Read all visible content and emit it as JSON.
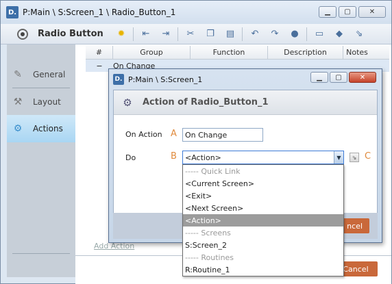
{
  "app": {
    "logo": "D.",
    "title": "P:Main \\ S:Screen_1 \\ Radio_Button_1",
    "window_buttons": [
      "minimize",
      "maximize",
      "close"
    ]
  },
  "toolbar": {
    "title": "Radio Button",
    "icons": [
      "lightbulb-icon",
      "outdent-icon",
      "indent-icon",
      "cut-icon",
      "copy-icon",
      "paste-icon",
      "undo-icon",
      "redo-icon",
      "comment-icon",
      "speech-bubble-icon",
      "diamond-icon",
      "arrow-icon"
    ]
  },
  "sidebar": {
    "items": [
      {
        "label": "General",
        "icon": "pencil-icon"
      },
      {
        "label": "Layout",
        "icon": "wrench-icon"
      },
      {
        "label": "Actions",
        "icon": "gears-icon",
        "active": true
      }
    ]
  },
  "table": {
    "columns": [
      "#",
      "Group",
      "Function",
      "Description",
      "Notes"
    ],
    "rows": [
      {
        "marker": "−",
        "group": "On Change"
      }
    ]
  },
  "add_action": "Add Action",
  "cancel_label": "Cancel",
  "dialog": {
    "title": "P:Main \\ S:Screen_1",
    "header": "Action of Radio_Button_1",
    "on_action_label": "On Action",
    "on_action_letter": "A",
    "on_action_value": "On Change",
    "do_label": "Do",
    "do_letter": "B",
    "do_value": "<Action>",
    "c_letter": "C",
    "cancel_label_visible": "ncel",
    "dropdown_items": [
      {
        "label": "----- Quick Link",
        "type": "header"
      },
      {
        "label": "<Current Screen>"
      },
      {
        "label": "<Exit>"
      },
      {
        "label": "<Next Screen>"
      },
      {
        "label": "<Action>",
        "selected": true
      },
      {
        "label": "----- Screens",
        "type": "header"
      },
      {
        "label": "S:Screen_2"
      },
      {
        "label": "----- Routines",
        "type": "header"
      },
      {
        "label": "R:Routine_1"
      }
    ]
  },
  "background_cancel_visible": "Cancel"
}
